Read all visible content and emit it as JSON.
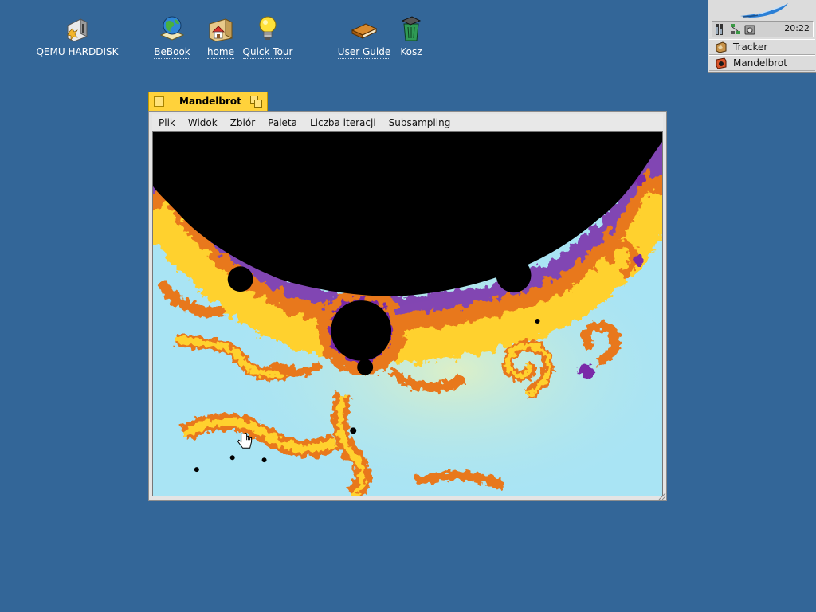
{
  "desktop": {
    "icons": [
      {
        "label": "QEMU HARDDISK",
        "icon": "harddisk-icon"
      },
      {
        "label": "BeBook",
        "icon": "bebook-globe-icon"
      },
      {
        "label": "home",
        "icon": "home-folder-icon"
      },
      {
        "label": "Quick Tour",
        "icon": "lightbulb-icon"
      },
      {
        "label": "User Guide",
        "icon": "book-icon"
      },
      {
        "label": "Kosz",
        "icon": "trash-icon"
      }
    ]
  },
  "deskbar": {
    "clock": "20:22",
    "apps": [
      {
        "label": "Tracker",
        "icon": "tracker-icon"
      },
      {
        "label": "Mandelbrot",
        "icon": "mandelbrot-app-icon"
      }
    ]
  },
  "window": {
    "title": "Mandelbrot",
    "menu": [
      "Plik",
      "Widok",
      "Zbiór",
      "Paleta",
      "Liczba iteracji",
      "Subsampling"
    ]
  },
  "colors": {
    "desktop": "#336698",
    "tab": "#ffd23b",
    "fractal_inside": "#000000",
    "fractal_outside": "#a9e4f4"
  }
}
